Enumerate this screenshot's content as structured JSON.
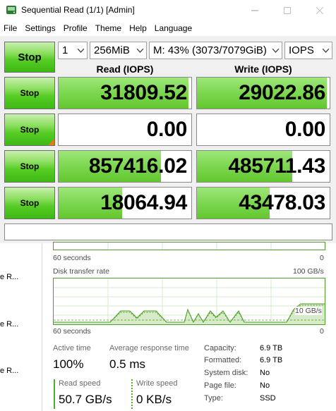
{
  "window": {
    "title": "Sequential Read (1/1) [Admin]"
  },
  "menu": [
    "File",
    "Settings",
    "Profile",
    "Theme",
    "Help",
    "Language"
  ],
  "controls": {
    "main_stop_label": "Stop",
    "count": "1",
    "size": "256MiB",
    "drive": "M: 43% (3073/7079GiB)",
    "unit": "IOPS"
  },
  "headers": {
    "read": "Read (IOPS)",
    "write": "Write (IOPS)"
  },
  "rows": [
    {
      "stop_label": "Stop",
      "read": "31809.52",
      "write": "29022.86",
      "read_fill": 0.98,
      "write_fill": 0.98
    },
    {
      "stop_label": "Stop",
      "read": "0.00",
      "write": "0.00",
      "read_fill": 0,
      "write_fill": 0
    },
    {
      "stop_label": "Stop",
      "read": "857416.02",
      "write": "485711.43",
      "read_fill": 0.77,
      "write_fill": 0.72
    },
    {
      "stop_label": "Stop",
      "read": "18064.94",
      "write": "43478.03",
      "read_fill": 0.48,
      "write_fill": 0.55
    }
  ],
  "taskmanager": {
    "strip_items": [
      "e R...",
      "e R...",
      "e R..."
    ],
    "top_graph_label": "60 seconds",
    "top_graph_value": "0",
    "disk_rate_label": "Disk transfer rate",
    "disk_rate_max": "100 GB/s",
    "disk_rate_marker": "10 GB/s",
    "disk_graph_time": "60 seconds",
    "disk_graph_zero": "0",
    "active_time_label": "Active time",
    "active_time": "100%",
    "avg_resp_label": "Average response time",
    "avg_resp": "0.5 ms",
    "read_speed_label": "Read speed",
    "read_speed": "50.7 GB/s",
    "write_speed_label": "Write speed",
    "write_speed": "0 KB/s",
    "props": [
      {
        "k": "Capacity:",
        "v": "6.9 TB"
      },
      {
        "k": "Formatted:",
        "v": "6.9 TB"
      },
      {
        "k": "System disk:",
        "v": "No"
      },
      {
        "k": "Page file:",
        "v": "No"
      },
      {
        "k": "Type:",
        "v": "SSD"
      }
    ]
  },
  "colors": {
    "accent_green": "#4caf2a",
    "graph_green": "#4d9e2b",
    "fill_green": "#7fd853"
  }
}
